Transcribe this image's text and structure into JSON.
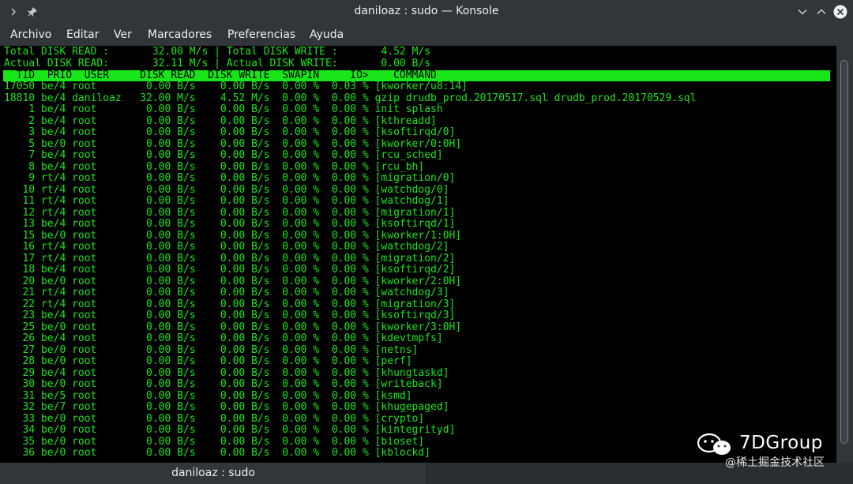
{
  "window": {
    "title": "daniloaz : sudo — Konsole",
    "icons": {
      "left": [
        "chevron-right-icon",
        "pin-icon"
      ],
      "right": [
        "minimize-icon",
        "maximize-icon",
        "close-icon"
      ]
    }
  },
  "menu": [
    "Archivo",
    "Editar",
    "Ver",
    "Marcadores",
    "Preferencias",
    "Ayuda"
  ],
  "iotop": {
    "total_line": "Total DISK READ :       32.00 M/s | Total DISK WRITE :       4.52 M/s",
    "actual_line": "Actual DISK READ:       32.11 M/s | Actual DISK WRITE:       0.00 B/s",
    "header": "  TID  PRIO  USER     DISK READ  DISK WRITE  SWAPIN     IO>    COMMAND",
    "rows": [
      "17050 be/4 root        0.00 B/s    0.00 B/s  0.00 %  0.03 % [kworker/u8:14]",
      "18810 be/4 daniloaz   32.00 M/s    4.52 M/s  0.00 %  0.00 % gzip drudb_prod.20170517.sql drudb_prod.20170529.sql",
      "    1 be/4 root        0.00 B/s    0.00 B/s  0.00 %  0.00 % init splash",
      "    2 be/4 root        0.00 B/s    0.00 B/s  0.00 %  0.00 % [kthreadd]",
      "    3 be/4 root        0.00 B/s    0.00 B/s  0.00 %  0.00 % [ksoftirqd/0]",
      "    5 be/0 root        0.00 B/s    0.00 B/s  0.00 %  0.00 % [kworker/0:0H]",
      "    7 be/4 root        0.00 B/s    0.00 B/s  0.00 %  0.00 % [rcu_sched]",
      "    8 be/4 root        0.00 B/s    0.00 B/s  0.00 %  0.00 % [rcu_bh]",
      "    9 rt/4 root        0.00 B/s    0.00 B/s  0.00 %  0.00 % [migration/0]",
      "   10 rt/4 root        0.00 B/s    0.00 B/s  0.00 %  0.00 % [watchdog/0]",
      "   11 rt/4 root        0.00 B/s    0.00 B/s  0.00 %  0.00 % [watchdog/1]",
      "   12 rt/4 root        0.00 B/s    0.00 B/s  0.00 %  0.00 % [migration/1]",
      "   13 be/4 root        0.00 B/s    0.00 B/s  0.00 %  0.00 % [ksoftirqd/1]",
      "   15 be/0 root        0.00 B/s    0.00 B/s  0.00 %  0.00 % [kworker/1:0H]",
      "   16 rt/4 root        0.00 B/s    0.00 B/s  0.00 %  0.00 % [watchdog/2]",
      "   17 rt/4 root        0.00 B/s    0.00 B/s  0.00 %  0.00 % [migration/2]",
      "   18 be/4 root        0.00 B/s    0.00 B/s  0.00 %  0.00 % [ksoftirqd/2]",
      "   20 be/0 root        0.00 B/s    0.00 B/s  0.00 %  0.00 % [kworker/2:0H]",
      "   21 rt/4 root        0.00 B/s    0.00 B/s  0.00 %  0.00 % [watchdog/3]",
      "   22 rt/4 root        0.00 B/s    0.00 B/s  0.00 %  0.00 % [migration/3]",
      "   23 be/4 root        0.00 B/s    0.00 B/s  0.00 %  0.00 % [ksoftirqd/3]",
      "   25 be/0 root        0.00 B/s    0.00 B/s  0.00 %  0.00 % [kworker/3:0H]",
      "   26 be/4 root        0.00 B/s    0.00 B/s  0.00 %  0.00 % [kdevtmpfs]",
      "   27 be/0 root        0.00 B/s    0.00 B/s  0.00 %  0.00 % [netns]",
      "   28 be/0 root        0.00 B/s    0.00 B/s  0.00 %  0.00 % [perf]",
      "   29 be/4 root        0.00 B/s    0.00 B/s  0.00 %  0.00 % [khungtaskd]",
      "   30 be/0 root        0.00 B/s    0.00 B/s  0.00 %  0.00 % [writeback]",
      "   31 be/5 root        0.00 B/s    0.00 B/s  0.00 %  0.00 % [ksmd]",
      "   32 be/7 root        0.00 B/s    0.00 B/s  0.00 %  0.00 % [khugepaged]",
      "   33 be/0 root        0.00 B/s    0.00 B/s  0.00 %  0.00 % [crypto]",
      "   34 be/0 root        0.00 B/s    0.00 B/s  0.00 %  0.00 % [kintegrityd]",
      "   35 be/0 root        0.00 B/s    0.00 B/s  0.00 %  0.00 % [bioset]",
      "   36 be/0 root        0.00 B/s    0.00 B/s  0.00 %  0.00 % [kblockd]"
    ]
  },
  "tab": {
    "label": "daniloaz : sudo"
  },
  "watermark": {
    "brand": "7DGroup",
    "sub": "@稀土掘金技术社区",
    "icon": "wechat-icon"
  },
  "colors": {
    "terminal_bg": "#000000",
    "terminal_fg": "#19e619",
    "chrome": "#31363b"
  }
}
